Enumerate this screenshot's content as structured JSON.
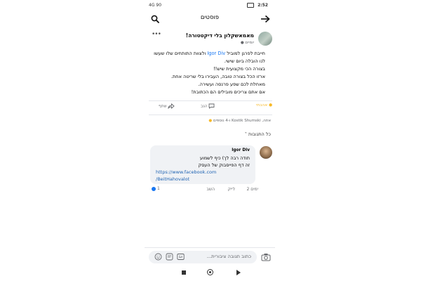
{
  "status_bar": {
    "time": "2:52",
    "left_text": "4G 90"
  },
  "header": {
    "title": "פוסטים"
  },
  "post": {
    "author": "מאמאשקלון בלי דיקטטורה!",
    "meta": "יומיים",
    "mention": "Igor Div",
    "body_line1_before": "חייבת לפרגן למוביל ",
    "body_line1_after": " ולצוות התותחים שלו שעשו",
    "body_lines": [
      "לנו הובלה ביום שישי.",
      "בצורה הכי מקצועית שיש!!",
      "ארזו הכל בצורה טובה, העבירו בלי שריטה אחת.",
      "מאחלת לכם שפע פרנסה ועשירה.",
      "אם אתם צריכים מובילים הם הכתובת!"
    ]
  },
  "actions": {
    "reaction": "אהבתי",
    "comment": "הגב",
    "share": "שתף"
  },
  "reactors_text": "אתה, Kostik Shumski ו-4 נוספים",
  "all_comments_label": "כל התגובות",
  "comment": {
    "author": "Igor Div",
    "line1": "תודה רבה לך) כיף לשמוע",
    "line2": "זה דף הפייסבוק של העסק",
    "link1": "https://www.facebook.com",
    "link2": "/BeitHahovalot",
    "time": "2 ימים",
    "like": "לייק",
    "reply": "השב",
    "likes_count": "1"
  },
  "composer": {
    "placeholder": "כתוב תגובה ציבורית..."
  },
  "colors": {
    "accent": "#1877f2",
    "reaction": "#f7b928"
  }
}
